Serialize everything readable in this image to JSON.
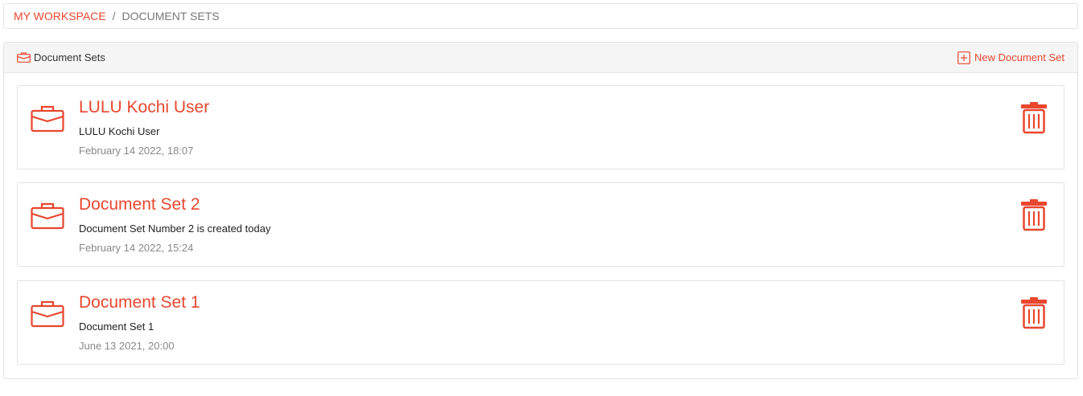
{
  "breadcrumb": {
    "root": "MY WORKSPACE",
    "separator": "/",
    "current": "DOCUMENT SETS"
  },
  "panel": {
    "title": "Document Sets",
    "title_icon": "briefcase-icon",
    "new_button_label": "New Document Set",
    "new_button_icon": "plus-square-icon"
  },
  "document_sets": [
    {
      "title": "LULU Kochi User",
      "description": "LULU Kochi User",
      "date": "February 14 2022, 18:07"
    },
    {
      "title": "Document Set 2",
      "description": "Document Set Number 2 is created today",
      "date": "February 14 2022, 15:24"
    },
    {
      "title": "Document Set 1",
      "description": "Document Set 1",
      "date": "June 13 2021, 20:00"
    }
  ],
  "colors": {
    "accent": "#e8472e",
    "border": "#e3e3e3",
    "header_bg": "#f5f5f5"
  }
}
